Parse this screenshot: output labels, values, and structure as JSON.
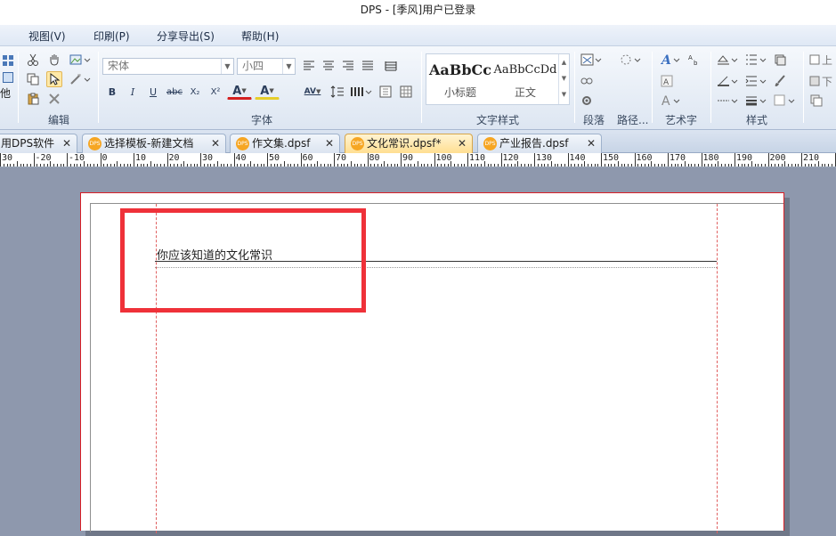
{
  "window": {
    "title": "DPS - [季风]用户已登录"
  },
  "menu": {
    "items": [
      "视图(V)",
      "印刷(P)",
      "分享导出(S)",
      "帮助(H)"
    ]
  },
  "ribbon": {
    "clipboard_group": {
      "label": "编辑",
      "side_label": "他"
    },
    "font_group": {
      "label": "字体",
      "font_name": "宋体",
      "font_size": "小四",
      "bold": "B",
      "italic": "I",
      "underline": "U",
      "strike": "abc",
      "subscript": "X₂",
      "superscript": "X²",
      "font_color": "A",
      "highlight": "A",
      "spacing": "AV"
    },
    "style_group": {
      "label": "文字样式",
      "styles": [
        {
          "sample": "AaBbCc",
          "name": "小标题"
        },
        {
          "sample": "AaBbCcDd",
          "name": "正文"
        }
      ]
    },
    "paragraph_group": {
      "label": "段落"
    },
    "path_group": {
      "label": "路径..."
    },
    "art_group": {
      "label": "艺术字"
    },
    "format_group": {
      "label": "样式"
    },
    "right_group": {
      "items": [
        "上",
        "下"
      ]
    }
  },
  "tabs": [
    {
      "label": "用DPS软件",
      "badge": "",
      "active": false
    },
    {
      "label": "选择模板-新建文档",
      "badge": "DPS",
      "active": false
    },
    {
      "label": "作文集.dpsf",
      "badge": "DPS",
      "active": false
    },
    {
      "label": "文化常识.dpsf*",
      "badge": "DPS",
      "active": true
    },
    {
      "label": "产业报告.dpsf",
      "badge": "DPS",
      "active": false
    }
  ],
  "ruler": {
    "labels": [
      "30",
      "-20",
      "-10",
      "0",
      "10",
      "20",
      "30",
      "40",
      "50",
      "60",
      "70",
      "80",
      "90",
      "100",
      "110",
      "120",
      "130",
      "140",
      "150",
      "160",
      "170",
      "180",
      "190",
      "200",
      "210",
      "220"
    ]
  },
  "document": {
    "title": "你应该知道的文化常识"
  },
  "colors": {
    "highlight_box": "#ef3139",
    "active_tab": "#ffdf91",
    "margin_line": "#e06060",
    "workspace": "#8e98ad"
  }
}
